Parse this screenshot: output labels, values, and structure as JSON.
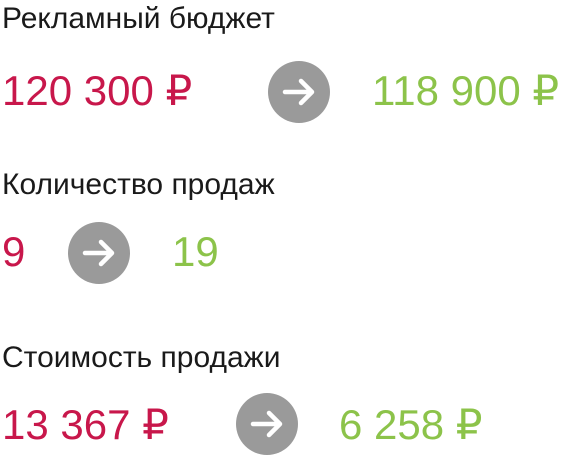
{
  "metrics": [
    {
      "label": "Рекламный бюджет",
      "old_value": "120 300 ₽",
      "new_value": "118 900 ₽",
      "arrow_icon": "arrow-right-icon"
    },
    {
      "label": "Количество продаж",
      "old_value": "9",
      "new_value": "19",
      "arrow_icon": "arrow-right-icon"
    },
    {
      "label": "Стоимость продажи",
      "old_value": "13 367 ₽",
      "new_value": "6 258 ₽",
      "arrow_icon": "arrow-right-icon"
    }
  ],
  "colors": {
    "old_value": "#c8174b",
    "new_value": "#8cc34a",
    "arrow_circle": "#9a9a9a",
    "label": "#1a1a1a"
  }
}
